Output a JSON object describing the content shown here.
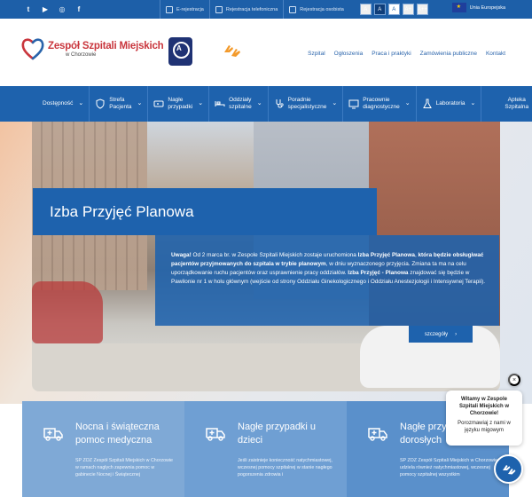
{
  "topbar": {
    "social": [
      {
        "icon": "twitter-icon",
        "glyph": "t"
      },
      {
        "icon": "youtube-icon",
        "glyph": "▶"
      },
      {
        "icon": "instagram-icon",
        "glyph": "◎"
      },
      {
        "icon": "facebook-icon",
        "glyph": "f"
      }
    ],
    "links": [
      {
        "label": "E-rejestracja",
        "icon": "e-registration-icon"
      },
      {
        "label": "Rejestracja telefoniczna",
        "icon": "phone-registration-icon"
      },
      {
        "label": "Rejestracja osobista",
        "icon": "personal-registration-icon"
      }
    ],
    "font_buttons": [
      "A",
      "A",
      "A",
      "A+",
      "A++"
    ],
    "eu_label": "Unia Europejska"
  },
  "header": {
    "logo_title": "Zespół Szpitali Miejskich",
    "logo_subtitle": "w Chorzowie",
    "accreditation_letter": "A",
    "nav": [
      "Szpital",
      "Ogłoszenia",
      "Praca i praktyki",
      "Zamówienia publiczne",
      "Kontakt"
    ]
  },
  "menu": [
    {
      "label": "Dostępność",
      "icon": "",
      "has_chevron": true
    },
    {
      "label": "Strefa\nPacjenta",
      "icon": "shield-icon",
      "has_chevron": true
    },
    {
      "label": "Nagłe\nprzypadki",
      "icon": "ambulance-icon",
      "has_chevron": true
    },
    {
      "label": "Oddziały\nszpitalne",
      "icon": "bed-icon",
      "has_chevron": true
    },
    {
      "label": "Poradnie\nspecjalistyczne",
      "icon": "stethoscope-icon",
      "has_chevron": true
    },
    {
      "label": "Pracownie\ndiagnostyczne",
      "icon": "monitor-icon",
      "has_chevron": true
    },
    {
      "label": "Laboratoria",
      "icon": "flask-icon",
      "has_chevron": true
    },
    {
      "label": "Apteka\nSzpitalna",
      "icon": "",
      "has_chevron": false
    }
  ],
  "hero": {
    "title": "Izba Przyjęć Planowa",
    "body_html_parts": [
      {
        "text": "Uwaga!",
        "bold": true
      },
      {
        "text": " Od 2 marca br. w Zespole Szpitali Miejskich zostaje uruchomiona ",
        "bold": false
      },
      {
        "text": "Izba Przyjęć Planowa",
        "bold": true
      },
      {
        "text": ", ",
        "bold": false
      },
      {
        "text": "która będzie obsługiwać pacjentów przyjmowanych do szpitala w trybie planowym",
        "bold": true
      },
      {
        "text": ", w dniu wyznaczonego przyjęcia. Zmiana ta ma na celu uporządkowanie ruchu pacjentów oraz usprawnienie pracy oddziałów. ",
        "bold": false
      },
      {
        "text": "Izba Przyjęć - Planowa",
        "bold": true
      },
      {
        "text": " znajdować się będzie w Pawilonie nr 1 w holu głównym (wejście od strony Oddziału Ginekologicznego i Oddziału Anestezjologii i Intensywnej Terapii).",
        "bold": false
      }
    ],
    "more_label": "szczegóły"
  },
  "cards": [
    {
      "title": "Nocna i świąteczna pomoc medyczna",
      "icon": "ambulance-icon",
      "body": "SP ZOZ Zespół Szpitali Miejskich w Chorzowie w ramach nagłych zapewnia pomoc w gabinecie Nocnej i Świątecznej"
    },
    {
      "title": "Nagłe przypadki u dzieci",
      "icon": "ambulance-icon",
      "body": "Jeśli zaistnieje konieczność natychmiastowej, wczesnej pomocy szpitalnej w stanie nagłego pogorszenia zdrowia i"
    },
    {
      "title": "Nagłe przypadki u dorosłych",
      "icon": "ambulance-icon",
      "body": "SP ZOZ Zespół Szpitali Miejskich w Chorzowie udziela również natychmiastowej, wczesnej pomocy szpitalnej wszystkim"
    }
  ],
  "chat": {
    "title": "Witamy w Zespole Szpitali Miejskich w Chorzowie!",
    "subtitle": "Porozmawiaj z nami w języku migowym",
    "close": "×"
  }
}
